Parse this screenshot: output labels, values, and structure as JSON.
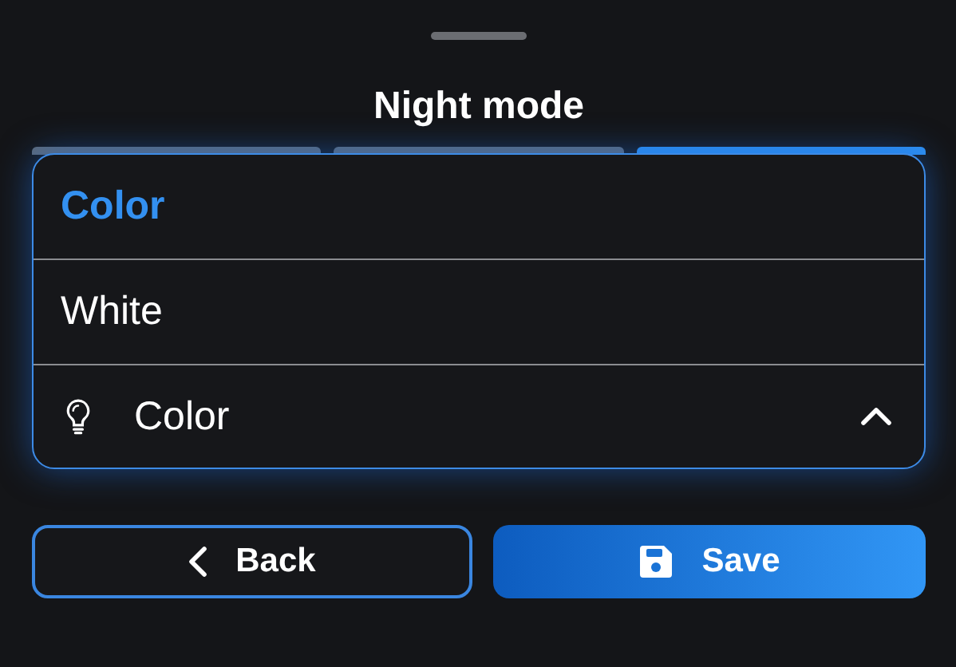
{
  "title": "Night mode",
  "steps": [
    {
      "selected": false
    },
    {
      "selected": false
    },
    {
      "selected": true
    }
  ],
  "dropdown": {
    "expanded": true,
    "value": "Color",
    "options": [
      {
        "label": "Color",
        "selected": true
      },
      {
        "label": "White",
        "selected": false
      }
    ]
  },
  "buttons": [
    {
      "kind": "back",
      "label": "Back"
    },
    {
      "kind": "save",
      "label": "Save"
    }
  ]
}
